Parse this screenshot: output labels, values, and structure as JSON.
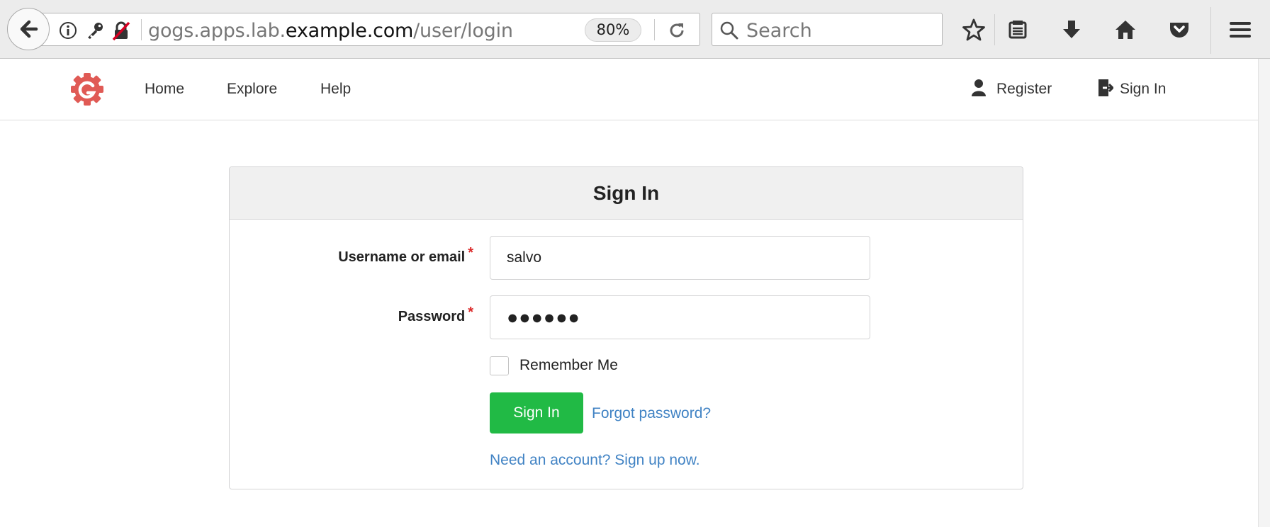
{
  "browser": {
    "url_prefix": "gogs.apps.lab.",
    "url_host": "example.com",
    "url_path": "/user/login",
    "zoom_level": "80%",
    "search_placeholder": "Search"
  },
  "nav": {
    "items": [
      {
        "label": "Home"
      },
      {
        "label": "Explore"
      },
      {
        "label": "Help"
      }
    ],
    "register_label": "Register",
    "signin_label": "Sign In"
  },
  "form": {
    "title": "Sign In",
    "username_label": "Username or email",
    "username_value": "salvo",
    "password_label": "Password",
    "password_masked": "●●●●●●",
    "required_marker": "*",
    "remember_label": "Remember Me",
    "remember_checked": false,
    "submit_label": "Sign In",
    "forgot_label": "Forgot password?",
    "signup_label": "Need an account? Sign up now."
  },
  "colors": {
    "logo": "#e05a55",
    "primary_button": "#21ba45",
    "link": "#4183c4",
    "required": "#db2828"
  },
  "icons": [
    "back-arrow-icon",
    "info-icon",
    "key-icon",
    "insecure-lock-icon",
    "reload-icon",
    "search-icon",
    "star-icon",
    "reading-list-icon",
    "download-icon",
    "home-icon",
    "pocket-icon",
    "hamburger-menu-icon",
    "gogs-logo-icon",
    "user-icon",
    "sign-in-icon"
  ]
}
